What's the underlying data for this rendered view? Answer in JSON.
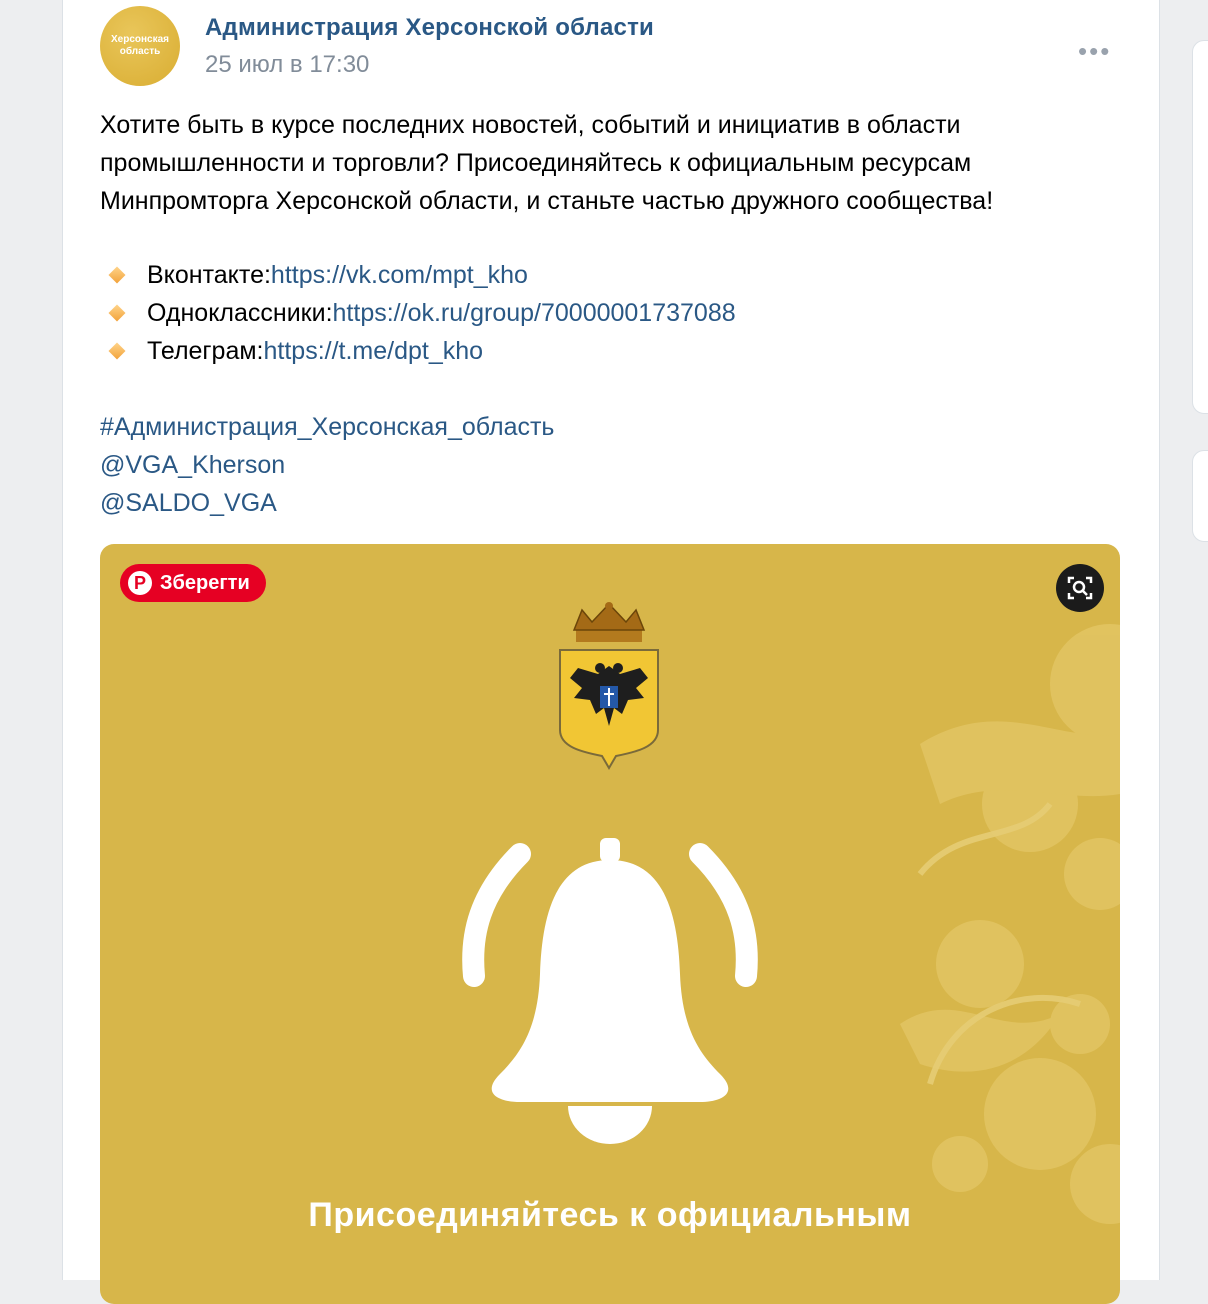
{
  "post": {
    "author": "Администрация Херсонской области",
    "date": "25 июл в 17:30",
    "avatar_text": "Херсонская область",
    "more_label": "•••",
    "text": "Хотите быть в курсе последних новостей, событий и инициатив в области промышленности и торговли? Присоединяйтесь к  официальным ресурсам Минпромторга Херсонской области, и станьте частью дружного сообщества!",
    "links": [
      {
        "label": "Вконтакте: ",
        "url": "https://vk.com/mpt_kho"
      },
      {
        "label": "Одноклассники: ",
        "url": "https://ok.ru/group/70000001737088"
      },
      {
        "label": "Телеграм: ",
        "url": "https://t.me/dpt_kho"
      }
    ],
    "tags": [
      "#Администрация_Херсонская_область",
      "@VGA_Kherson",
      "@SALDO_VGA"
    ]
  },
  "image": {
    "pin_label": "Зберегти",
    "pin_logo": "P",
    "promo_text": "Присоединяйтесь к официальным",
    "colors": {
      "background": "#d7b64a",
      "bell": "#ffffff"
    }
  },
  "icons": [
    "pinterest-icon",
    "visual-search-icon",
    "coat-of-arms-icon",
    "bell-icon",
    "more-icon"
  ]
}
